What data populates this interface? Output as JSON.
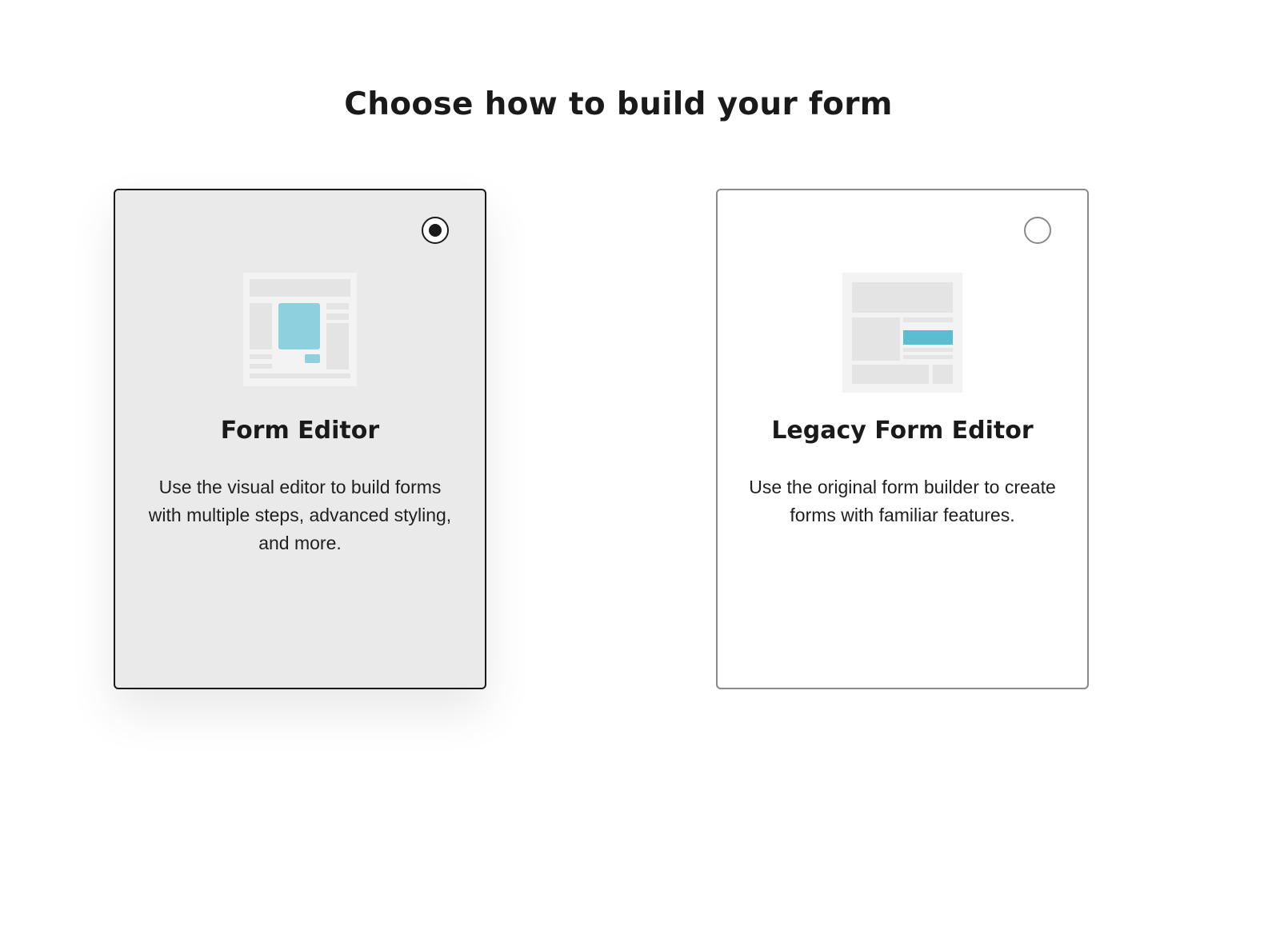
{
  "header": {
    "title": "Choose how to build your form"
  },
  "options": [
    {
      "title": "Form Editor",
      "description": "Use the visual editor to build forms with multiple steps, advanced styling, and more.",
      "selected": true
    },
    {
      "title": "Legacy Form Editor",
      "description": "Use the original form builder to create forms with familiar features.",
      "selected": false
    }
  ],
  "colors": {
    "selected_card_bg": "#eaeaea",
    "accent_teal": "#8fd0de",
    "accent_teal_dark": "#5bbdd2",
    "text": "#1a1a1a"
  }
}
